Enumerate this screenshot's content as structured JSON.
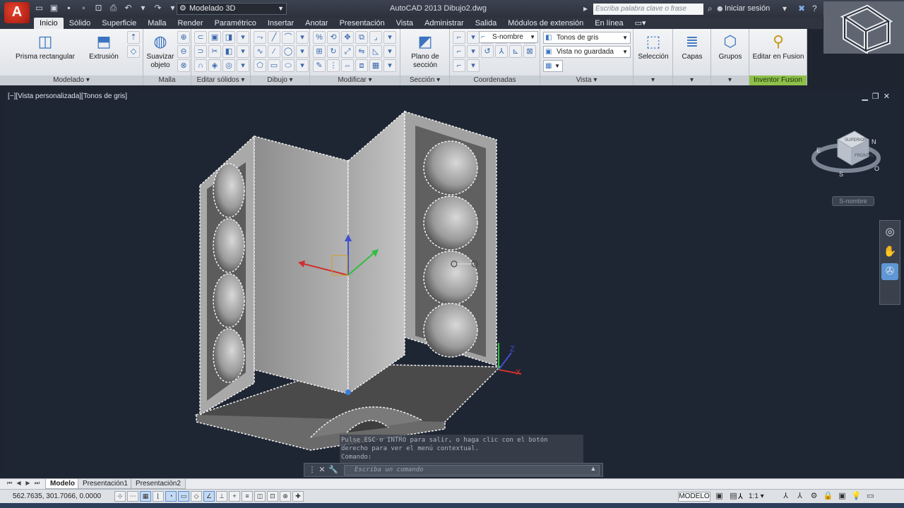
{
  "titlebar": {
    "app_button": "A",
    "workspace": "Modelado 3D",
    "title": "AutoCAD 2013    Dibujo2.dwg",
    "search_placeholder": "Escriba palabra clave o frase",
    "signin": "Iniciar sesión"
  },
  "tabs": [
    "Inicio",
    "Sólido",
    "Superficie",
    "Malla",
    "Render",
    "Paramétrico",
    "Insertar",
    "Anotar",
    "Presentación",
    "Vista",
    "Administrar",
    "Salida",
    "Módulos de extensión",
    "En línea"
  ],
  "ribbon": {
    "panels": {
      "modelado": "Modelado ▾",
      "malla": "Malla",
      "editar_solidos": "Editar sólidos ▾",
      "dibujo": "Dibujo ▾",
      "modificar": "Modificar ▾",
      "seccion": "Sección ▾",
      "coordenadas": "Coordenadas",
      "vista": "Vista ▾",
      "inventor": "Inventor Fusion"
    },
    "buttons": {
      "prisma": "Prisma rectangular",
      "extrusion": "Extrusión",
      "suavizar": "Suavizar objeto",
      "plano": "Plano de sección",
      "seleccion": "Selección",
      "capas": "Capas",
      "grupos": "Grupos",
      "editar_fusion": "Editar en Fusion"
    },
    "visual_style": "Tonos de gris",
    "saved_view": "Vista no guardada",
    "ucs_dropdown": "S-nombre"
  },
  "viewport": {
    "label": "[−][Vista personalizada][Tonos de gris]",
    "ucs_name": "S-nombre",
    "viewcube_face": "FRONTAL",
    "viewcube_top": "SUPERIOR",
    "compass_n": "N",
    "compass_e": "E",
    "compass_s": "S",
    "compass_o": "O",
    "axis_x": "X",
    "axis_z": "Z"
  },
  "command": {
    "history_1": "Pulse ESC o INTRO para salir, o haga clic con el botón",
    "history_2": "derecho para ver el menú contextual.",
    "history_3": "Comando:",
    "placeholder": "Escriba un comando"
  },
  "layout_tabs": [
    "Modelo",
    "Presentación1",
    "Presentación2"
  ],
  "status": {
    "coords": "562.7635, 301.7066, 0.0000",
    "model": "MODELO",
    "scale": "1:1 ▾"
  },
  "colors": {
    "viewport_bg": "#1f2633",
    "accent": "#3b74c0",
    "inventor": "#8fbf4a"
  }
}
